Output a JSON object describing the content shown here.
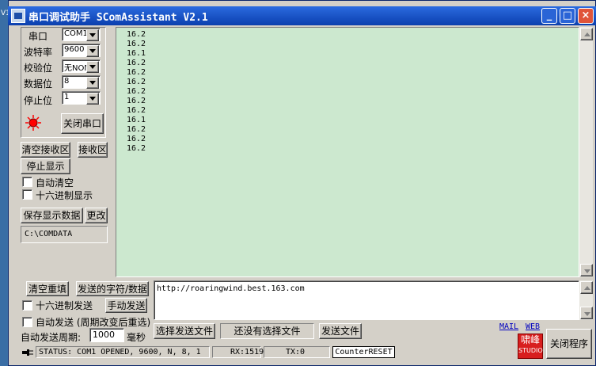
{
  "desktop": {
    "edge_label": "V1"
  },
  "window": {
    "title": "串口调试助手  SComAssistant V2.1"
  },
  "titlebar_buttons": {
    "minimize": "_",
    "maximize": "□",
    "close": "×"
  },
  "settings": {
    "port_label": "串口",
    "port_value": "COM1",
    "baud_label": "波特率",
    "baud_value": "9600",
    "parity_label": "校验位",
    "parity_value": "无NON",
    "databits_label": "数据位",
    "databits_value": "8",
    "stopbits_label": "停止位",
    "stopbits_value": "1",
    "close_port_button": "关闭串口",
    "indicator_color": "#ff0000"
  },
  "receive": {
    "clear_button": "清空接收区",
    "area_button": "接收区",
    "stop_display_button": "停止显示",
    "auto_clear_label": "自动清空",
    "hex_display_label": "十六进制显示",
    "save_button": "保存显示数据",
    "change_button": "更改",
    "save_path": "C:\\COMDATA",
    "lines": [
      "16.2",
      "16.2",
      "16.1",
      "16.2",
      "16.2",
      "16.2",
      "16.2",
      "16.2",
      "16.2",
      "16.1",
      "16.2",
      "16.2",
      "16.2"
    ]
  },
  "send": {
    "clear_button": "清空重填",
    "chars_button": "发送的字符/数据",
    "hex_send_label": "十六进制发送",
    "manual_send_button": "手动发送",
    "auto_send_label": "自动发送 (周期改变后重选)",
    "period_label": "自动发送周期:",
    "period_value": "1000",
    "period_unit": "毫秒",
    "text": "http://roaringwind.best.163.com",
    "select_file_button": "选择发送文件",
    "file_status": "还没有选择文件",
    "send_file_button": "发送文件"
  },
  "links": {
    "mail": "MAIL",
    "web": "WEB"
  },
  "logo": {
    "line1": "啸峰",
    "line2": "STUDIO"
  },
  "close_program_button": "关闭程序",
  "status": {
    "status_text": "STATUS: COM1 OPENED, 9600, N, 8, 1",
    "rx": "RX:1519",
    "tx": "TX:0",
    "counter_reset": "CounterRESET"
  }
}
